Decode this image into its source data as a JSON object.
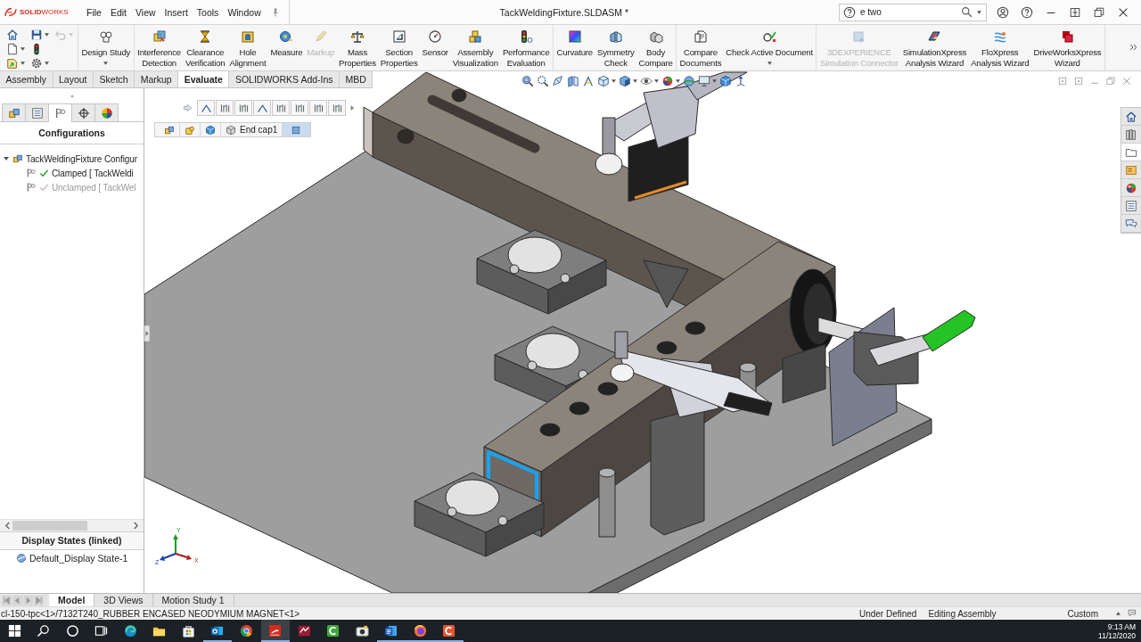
{
  "titlebar": {
    "logo": "**SOLID**WORKS",
    "menus": [
      "File",
      "Edit",
      "View",
      "Insert",
      "Tools",
      "Window"
    ],
    "title": "TackWeldingFixture.SLDASM *",
    "search": {
      "value": "e two"
    }
  },
  "quick_access": {
    "undo": {
      "disabled": true
    }
  },
  "ribbon": [
    {
      "buttons": [
        {
          "label": "Design Study",
          "disabled": false,
          "dropdown": true
        }
      ]
    },
    {
      "buttons": [
        {
          "label": "Interference\nDetection",
          "disabled": false,
          "dropdown": false
        },
        {
          "label": "Clearance\nVerification",
          "disabled": false,
          "dropdown": false
        },
        {
          "label": "Hole\nAlignment",
          "disabled": false,
          "dropdown": false
        },
        {
          "label": "Measure",
          "disabled": false,
          "dropdown": false
        },
        {
          "label": "Markup",
          "disabled": true,
          "dropdown": false
        },
        {
          "label": "Mass\nProperties",
          "disabled": false,
          "dropdown": false
        },
        {
          "label": "Section\nProperties",
          "disabled": false,
          "dropdown": false
        },
        {
          "label": "Sensor",
          "disabled": false,
          "dropdown": false
        },
        {
          "label": "Assembly\nVisualization",
          "disabled": false,
          "dropdown": false
        },
        {
          "label": "Performance\nEvaluation",
          "disabled": false,
          "dropdown": false
        }
      ]
    },
    {
      "buttons": [
        {
          "label": "Curvature",
          "disabled": false,
          "dropdown": false
        },
        {
          "label": "Symmetry\nCheck",
          "disabled": false,
          "dropdown": false
        },
        {
          "label": "Body\nCompare",
          "disabled": false,
          "dropdown": false
        }
      ]
    },
    {
      "buttons": [
        {
          "label": "Compare\nDocuments",
          "disabled": false,
          "dropdown": false
        },
        {
          "label": "Check Active Document",
          "disabled": false,
          "dropdown": true
        }
      ]
    },
    {
      "buttons": [
        {
          "label": "3DEXPERIENCE\nSimulation Connector",
          "disabled": true,
          "dropdown": false
        },
        {
          "label": "SimulationXpress\nAnalysis Wizard",
          "disabled": false,
          "dropdown": false
        },
        {
          "label": "FloXpress\nAnalysis Wizard",
          "disabled": false,
          "dropdown": false
        },
        {
          "label": "DriveWorksXpress\nWizard",
          "disabled": false,
          "dropdown": false
        }
      ]
    }
  ],
  "tabs": [
    {
      "label": "Assembly",
      "selected": false
    },
    {
      "label": "Layout",
      "selected": false
    },
    {
      "label": "Sketch",
      "selected": false
    },
    {
      "label": "Markup",
      "selected": false
    },
    {
      "label": "Evaluate",
      "selected": true
    },
    {
      "label": "SOLIDWORKS Add-Ins",
      "selected": false
    },
    {
      "label": "MBD",
      "selected": false
    }
  ],
  "panel": {
    "manager_tabs": [
      {
        "selected": false
      },
      {
        "selected": false
      },
      {
        "selected": true
      },
      {
        "selected": false
      },
      {
        "selected": false
      }
    ],
    "configurations": {
      "title": "Configurations",
      "tree": [
        {
          "label": "TackWeldingFixture Configur",
          "expanded": true,
          "children": [
            {
              "label": "Clamped [ TackWeldi",
              "active": true
            },
            {
              "label": "Unclamped [ TackWel",
              "active": false
            }
          ]
        }
      ]
    },
    "display_states": {
      "title": "Display States (linked)",
      "items": [
        "Default_Display State-1"
      ]
    }
  },
  "viewport": {
    "breadcrumb": [
      {
        "selected": false
      },
      {
        "selected": false
      },
      {
        "selected": false
      },
      {
        "label": "End cap1",
        "selected": false
      },
      {
        "selected": true
      }
    ],
    "triad": {
      "x": "X",
      "y": "Y",
      "z": "Z"
    },
    "task_pane": [
      {
        "selected": false
      },
      {
        "selected": false
      },
      {
        "selected": true
      },
      {
        "selected": false
      },
      {
        "selected": false
      },
      {
        "selected": false
      },
      {
        "selected": false
      }
    ]
  },
  "bottom_tabs": [
    {
      "label": "Model",
      "selected": true
    },
    {
      "label": "3D Views",
      "selected": false
    },
    {
      "label": "Motion Study 1",
      "selected": false
    }
  ],
  "status_bar": {
    "component": "cl-150-tpc<1>/7132T240_RUBBER ENCASED NEODYMIUM MAGNET<1>",
    "definition": "Under Defined",
    "mode": "Editing Assembly",
    "units": "Custom"
  },
  "taskbar": {
    "apps": [
      {
        "selected": false,
        "running": false
      },
      {
        "selected": false,
        "running": false
      },
      {
        "selected": false,
        "running": false
      },
      {
        "selected": false,
        "running": true
      },
      {
        "selected": false,
        "running": false
      },
      {
        "selected": true,
        "running": true
      },
      {
        "selected": false,
        "running": false
      },
      {
        "selected": false,
        "running": false
      },
      {
        "selected": false,
        "running": false
      },
      {
        "selected": false,
        "running": true
      },
      {
        "selected": false,
        "running": true
      },
      {
        "selected": false,
        "running": true
      }
    ],
    "time": "9:13 AM",
    "date": "11/12/2020"
  }
}
